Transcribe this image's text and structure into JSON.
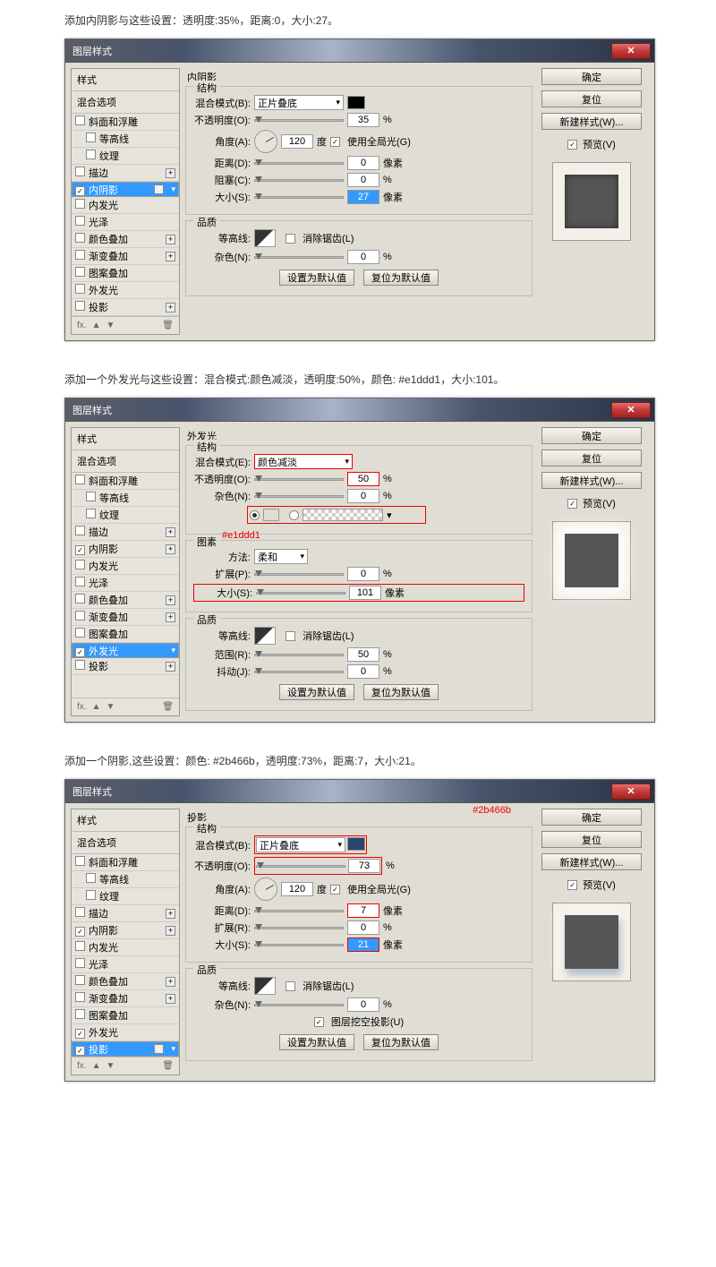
{
  "sections": [
    {
      "caption": "添加内阴影与这些设置：透明度:35%，距离:0，大小:27。"
    },
    {
      "caption": "添加一个外发光与这些设置：混合模式:颜色减淡，透明度:50%，颜色: #e1ddd1，大小:101。"
    },
    {
      "caption": "添加一个阴影,这些设置：颜色: #2b466b，透明度:73%，距离:7，大小:21。"
    }
  ],
  "common": {
    "title": "图层样式",
    "styles": "样式",
    "blendOptions": "混合选项",
    "items": [
      "斜面和浮雕",
      "等高线",
      "纹理",
      "描边",
      "内阴影",
      "内发光",
      "光泽",
      "颜色叠加",
      "渐变叠加",
      "图案叠加",
      "外发光",
      "投影"
    ],
    "fx": "fx.",
    "rc": {
      "ok": "确定",
      "reset": "复位",
      "new": "新建样式(W)...",
      "preview": "预览(V)"
    }
  },
  "p1": {
    "title": "内阴影",
    "struct": "结构",
    "quality": "品质",
    "blend": "混合模式(B):",
    "blend_v": "正片叠底",
    "opacity": "不透明度(O):",
    "opacity_v": "35",
    "pct": "%",
    "angle": "角度(A):",
    "angle_v": "120",
    "deg": "度",
    "global": "使用全局光(G)",
    "dist": "距离(D):",
    "dist_v": "0",
    "px": "像素",
    "choke": "阻塞(C):",
    "choke_v": "0",
    "size": "大小(S):",
    "size_v": "27",
    "contour": "等高线:",
    "anti": "消除锯齿(L)",
    "noise": "杂色(N):",
    "noise_v": "0",
    "setdef": "设置为默认值",
    "resetdef": "复位为默认值"
  },
  "p2": {
    "title": "外发光",
    "struct": "结构",
    "elements": "图素",
    "quality": "品质",
    "blend": "混合模式(E):",
    "blend_v": "颜色减淡",
    "opacity": "不透明度(O):",
    "opacity_v": "50",
    "pct": "%",
    "noise": "杂色(N):",
    "noise_v": "0",
    "colornote": "#e1ddd1",
    "method": "方法:",
    "method_v": "柔和",
    "spread": "扩展(P):",
    "spread_v": "0",
    "size": "大小(S):",
    "size_v": "101",
    "px": "像素",
    "contour": "等高线:",
    "anti": "消除锯齿(L)",
    "range": "范围(R):",
    "range_v": "50",
    "jitter": "抖动(J):",
    "jitter_v": "0",
    "setdef": "设置为默认值",
    "resetdef": "复位为默认值"
  },
  "p3": {
    "title": "投影",
    "struct": "结构",
    "quality": "品质",
    "colornote": "#2b466b",
    "blend": "混合模式(B):",
    "blend_v": "正片叠底",
    "opacity": "不透明度(O):",
    "opacity_v": "73",
    "pct": "%",
    "angle": "角度(A):",
    "angle_v": "120",
    "deg": "度",
    "global": "使用全局光(G)",
    "dist": "距离(D):",
    "dist_v": "7",
    "px": "像素",
    "spread": "扩展(R):",
    "spread_v": "0",
    "size": "大小(S):",
    "size_v": "21",
    "contour": "等高线:",
    "anti": "消除锯齿(L)",
    "noise": "杂色(N):",
    "noise_v": "0",
    "knockout": "图层挖空投影(U)",
    "setdef": "设置为默认值",
    "resetdef": "复位为默认值"
  }
}
